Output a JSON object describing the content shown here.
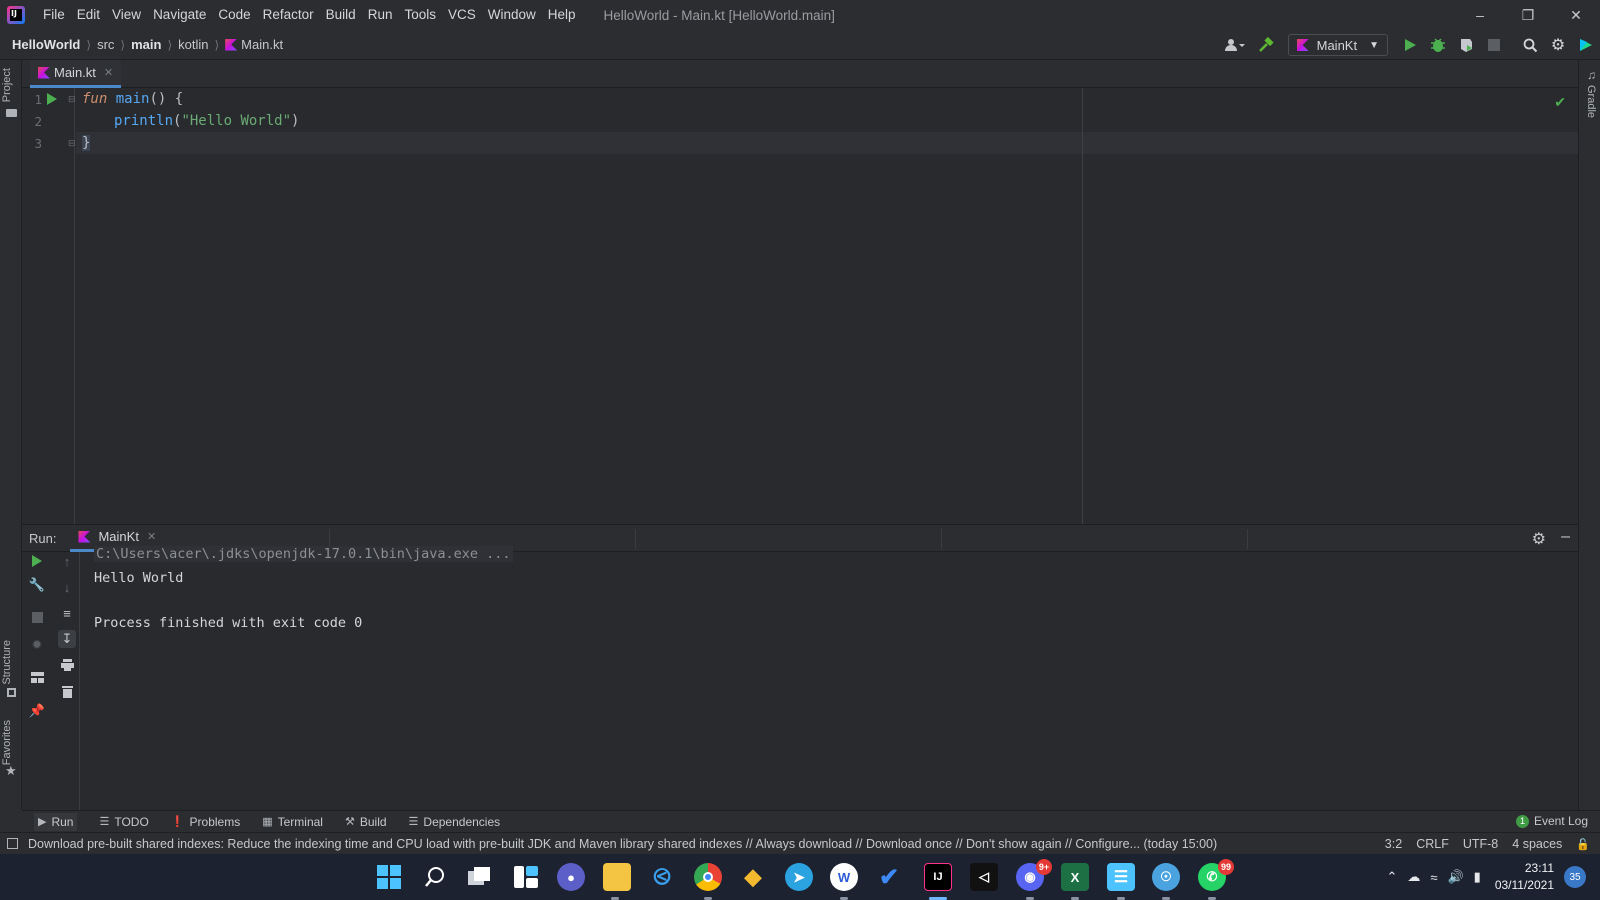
{
  "app": {
    "menu": [
      "File",
      "Edit",
      "View",
      "Navigate",
      "Code",
      "Refactor",
      "Build",
      "Run",
      "Tools",
      "VCS",
      "Window",
      "Help"
    ],
    "window_title": "HelloWorld - Main.kt [HelloWorld.main]"
  },
  "breadcrumb": [
    "HelloWorld",
    "src",
    "main",
    "kotlin",
    "Main.kt"
  ],
  "toolbar": {
    "run_config": "MainKt"
  },
  "side_tabs": {
    "left_top": "Project",
    "left_structure": "Structure",
    "left_favorites": "Favorites",
    "right_gradle": "Gradle"
  },
  "editor": {
    "tab_label": "Main.kt",
    "lines": [
      {
        "num": "1",
        "kw": "fun",
        "name": "main",
        "rest": "() {"
      },
      {
        "num": "2",
        "call": "println",
        "open": "(",
        "str": "\"Hello World\"",
        "close": ")"
      },
      {
        "num": "3",
        "text": "}"
      }
    ]
  },
  "run_panel": {
    "label": "Run:",
    "tab_label": "MainKt",
    "console": [
      "C:\\Users\\acer\\.jdks\\openjdk-17.0.1\\bin\\java.exe ...",
      "Hello World",
      "",
      "Process finished with exit code 0"
    ]
  },
  "bottom_tabs": [
    "Run",
    "TODO",
    "Problems",
    "Terminal",
    "Build",
    "Dependencies"
  ],
  "event_log": {
    "label": "Event Log",
    "count": "1"
  },
  "status": {
    "message": "Download pre-built shared indexes: Reduce the indexing time and CPU load with pre-built JDK and Maven library shared indexes // Always download // Download once // Don't show again // Configure... (today 15:00)",
    "position": "3:2",
    "line_sep": "CRLF",
    "encoding": "UTF-8",
    "indent": "4 spaces"
  },
  "taskbar": {
    "discord_badge": "9+",
    "whatsapp_badge": "99",
    "time": "23:11",
    "date": "03/11/2021",
    "notifications": "35"
  },
  "colors": {
    "accent": "#4a88c7",
    "run_green": "#4caf50"
  }
}
